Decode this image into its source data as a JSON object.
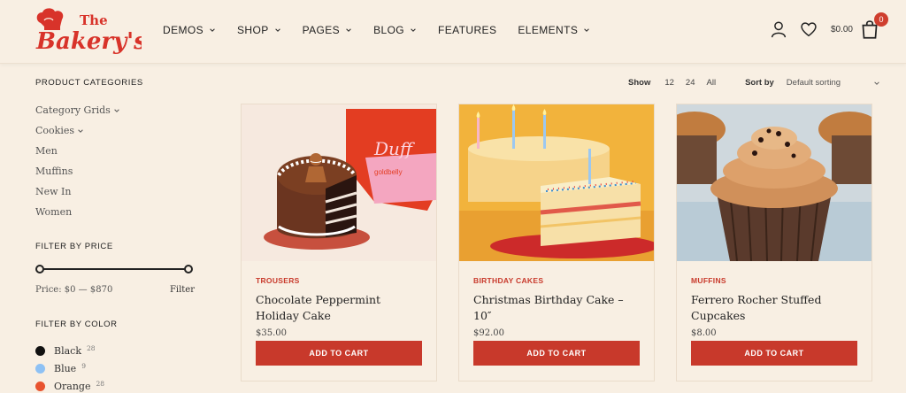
{
  "logo": {
    "text_top": "The",
    "text_main": "Bakery's"
  },
  "nav": [
    {
      "label": "DEMOS",
      "has_dropdown": true
    },
    {
      "label": "SHOP",
      "has_dropdown": true
    },
    {
      "label": "PAGES",
      "has_dropdown": true
    },
    {
      "label": "BLOG",
      "has_dropdown": true
    },
    {
      "label": "FEATURES",
      "has_dropdown": false
    },
    {
      "label": "ELEMENTS",
      "has_dropdown": true
    }
  ],
  "header": {
    "cart_total": "$0.00",
    "cart_count": "0",
    "icons": [
      "user-icon",
      "heart-icon",
      "shopping-bag-icon"
    ]
  },
  "sidebar": {
    "categories_title": "PRODUCT CATEGORIES",
    "categories": [
      {
        "label": "Category Grids",
        "has_dropdown": true
      },
      {
        "label": "Cookies",
        "has_dropdown": true
      },
      {
        "label": "Men",
        "has_dropdown": false
      },
      {
        "label": "Muffins",
        "has_dropdown": false
      },
      {
        "label": "New In",
        "has_dropdown": false
      },
      {
        "label": "Women",
        "has_dropdown": false
      }
    ],
    "price_title": "FILTER BY PRICE",
    "price_range_text": "Price: $0 — $870",
    "filter_label": "Filter",
    "color_title": "FILTER BY COLOR",
    "colors": [
      {
        "label": "Black",
        "count": "28",
        "hex": "#111111"
      },
      {
        "label": "Blue",
        "count": "9",
        "hex": "#8ec1f4"
      },
      {
        "label": "Orange",
        "count": "28",
        "hex": "#e8532f"
      }
    ]
  },
  "toolbar": {
    "show_label": "Show",
    "show_options": [
      "12",
      "24",
      "All"
    ],
    "sort_label": "Sort by",
    "sort_value": "Default sorting"
  },
  "products": [
    {
      "category": "TROUSERS",
      "title": "Chocolate Peppermint Holiday Cake",
      "price": "$35.00",
      "button": "ADD TO CART",
      "image_icon": "chocolate-cake-image",
      "box_text": "Duff",
      "box_sub": "goldbelly"
    },
    {
      "category": "BIRTHDAY CAKES",
      "title": "Christmas Birthday Cake – 10″",
      "price": "$92.00",
      "button": "ADD TO CART",
      "image_icon": "birthday-cake-image"
    },
    {
      "category": "MUFFINS",
      "title": "Ferrero Rocher Stuffed Cupcakes",
      "price": "$8.00",
      "button": "ADD TO CART",
      "image_icon": "cupcake-image"
    }
  ],
  "colors": {
    "accent": "#c8392b",
    "background": "#f8efe3"
  }
}
